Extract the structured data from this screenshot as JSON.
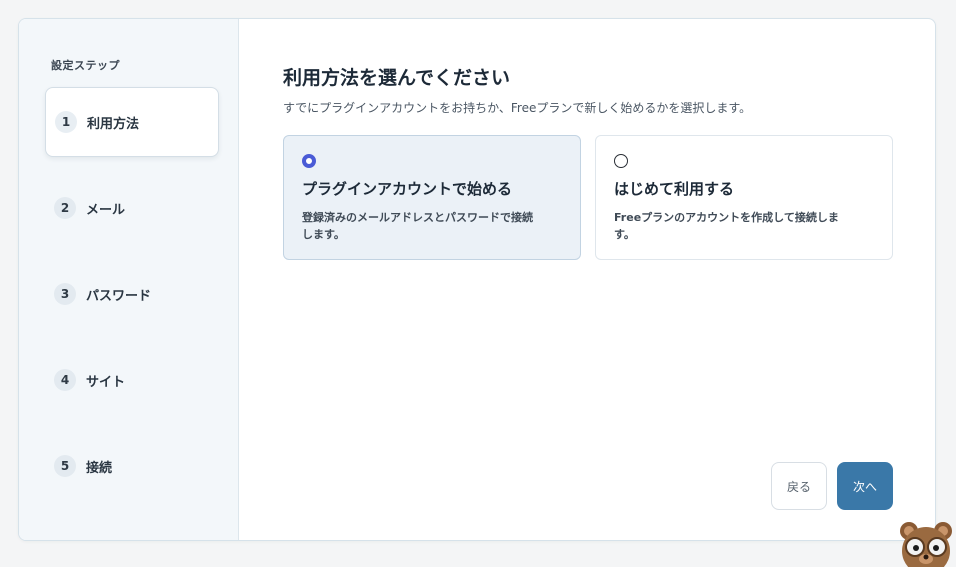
{
  "sidebar": {
    "title": "設定ステップ",
    "steps": [
      {
        "num": "1",
        "label": "利用方法"
      },
      {
        "num": "2",
        "label": "メール"
      },
      {
        "num": "3",
        "label": "パスワード"
      },
      {
        "num": "4",
        "label": "サイト"
      },
      {
        "num": "5",
        "label": "接続"
      }
    ],
    "active_step": 1
  },
  "main": {
    "title": "利用方法を選んでください",
    "subtitle": "すでにプラグインアカウントをお持ちか、Freeプランで新しく始めるかを選択します。",
    "options": [
      {
        "title": "プラグインアカウントで始める",
        "description": "登録済みのメールアドレスとパスワードで接続します。",
        "selected": true
      },
      {
        "title": "はじめて利用する",
        "description": "Freeプランのアカウントを作成して接続します。",
        "selected": false
      }
    ]
  },
  "footer": {
    "back_label": "戻る",
    "next_label": "次へ"
  },
  "colors": {
    "accent": "#3a78a8",
    "radio_checked": "#4a5bd6",
    "selected_card_bg": "#ebf1f7",
    "sidebar_bg": "#f3f7fa"
  },
  "icons": {
    "mascot": "bear-mascot-icon"
  }
}
